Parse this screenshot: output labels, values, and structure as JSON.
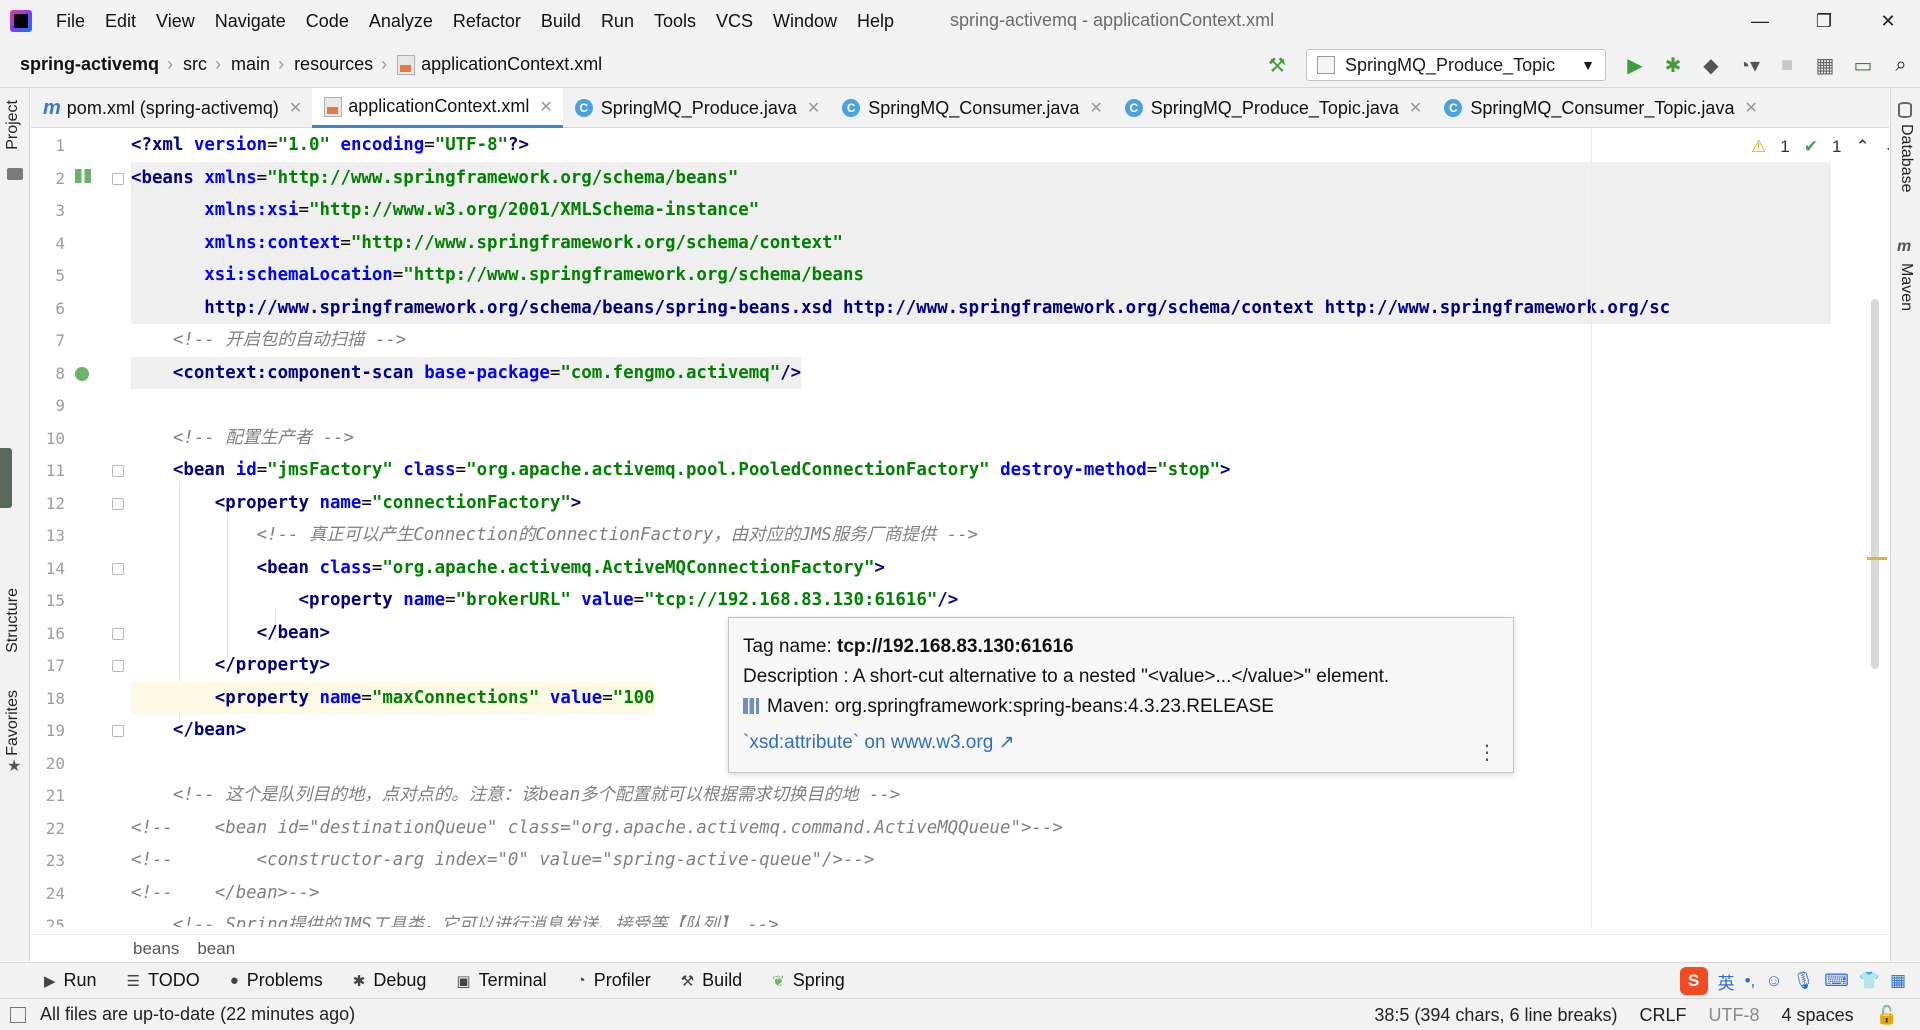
{
  "window": {
    "title": "spring-activemq - applicationContext.xml",
    "menu": [
      "File",
      "Edit",
      "View",
      "Navigate",
      "Code",
      "Analyze",
      "Refactor",
      "Build",
      "Run",
      "Tools",
      "VCS",
      "Window",
      "Help"
    ],
    "controls": {
      "minimize": "—",
      "maximize": "❐",
      "close": "✕"
    }
  },
  "navbar": {
    "breadcrumbs": [
      "spring-activemq",
      "src",
      "main",
      "resources",
      "applicationContext.xml"
    ],
    "run_config": "SpringMQ_Produce_Topic",
    "icons": [
      "hammer-icon",
      "run-icon",
      "debug-icon",
      "coverage-icon",
      "profile-icon",
      "stop-icon",
      "project-structure-icon",
      "terminal-icon",
      "search-icon"
    ]
  },
  "side_tabs": {
    "left": [
      "Project",
      "Structure",
      "Favorites"
    ],
    "right": [
      "Database",
      "Maven"
    ]
  },
  "tabs": [
    {
      "label": "pom.xml (spring-activemq)",
      "icon": "maven-icon",
      "close": "✕"
    },
    {
      "label": "applicationContext.xml",
      "icon": "xml-icon",
      "close": "✕"
    },
    {
      "label": "SpringMQ_Produce.java",
      "icon": "class-icon",
      "close": "✕"
    },
    {
      "label": "SpringMQ_Consumer.java",
      "icon": "class-icon",
      "close": "✕"
    },
    {
      "label": "SpringMQ_Produce_Topic.java",
      "icon": "class-icon",
      "close": "✕"
    },
    {
      "label": "SpringMQ_Consumer_Topic.java",
      "icon": "class-icon",
      "close": "✕"
    }
  ],
  "inspections": {
    "warnings": "1",
    "weak_warnings": "1"
  },
  "editor": {
    "line_numbers": [
      "1",
      "2",
      "3",
      "4",
      "5",
      "6",
      "7",
      "8",
      "9",
      "10",
      "11",
      "12",
      "13",
      "14",
      "15",
      "16",
      "17",
      "18",
      "19",
      "20",
      "21",
      "22",
      "23",
      "24",
      "25"
    ],
    "lines": [
      "<?xml version=\"1.0\" encoding=\"UTF-8\"?>",
      "<beans xmlns=\"http://www.springframework.org/schema/beans\"",
      "       xmlns:xsi=\"http://www.w3.org/2001/XMLSchema-instance\"",
      "       xmlns:context=\"http://www.springframework.org/schema/context\"",
      "       xsi:schemaLocation=\"http://www.springframework.org/schema/beans",
      "       http://www.springframework.org/schema/beans/spring-beans.xsd http://www.springframework.org/schema/context http://www.springframework.org/sc",
      "    <!-- 开启包的自动扫描 -->",
      "    <context:component-scan base-package=\"com.fengmo.activemq\"/>",
      "",
      "    <!-- 配置生产者 -->",
      "    <bean id=\"jmsFactory\" class=\"org.apache.activemq.pool.PooledConnectionFactory\" destroy-method=\"stop\">",
      "        <property name=\"connectionFactory\">",
      "            <!-- 真正可以产生Connection的ConnectionFactory，由对应的JMS服务厂商提供 -->",
      "            <bean class=\"org.apache.activemq.ActiveMQConnectionFactory\">",
      "                <property name=\"brokerURL\" value=\"tcp://192.168.83.130:61616\"/>",
      "            </bean>",
      "        </property>",
      "        <property name=\"maxConnections\" value=\"100",
      "    </bean>",
      "",
      "    <!-- 这个是队列目的地，点对点的。注意：该bean多个配置就可以根据需求切换目的地 -->",
      "<!--    <bean id=\"destinationQueue\" class=\"org.apache.activemq.command.ActiveMQQueue\">-->",
      "<!--        <constructor-arg index=\"0\" value=\"spring-active-queue\"/>-->",
      "<!--    </bean>-->",
      "    <!-- Spring提供的JMS工具类，它可以进行消息发送、接受等【队列】 -->"
    ]
  },
  "tooltip": {
    "tag_label": "Tag name: ",
    "tag_value": "tcp://192.168.83.130:61616",
    "description": "Description : A short-cut alternative to a nested \"<value>...</value>\" element.",
    "maven": "Maven: org.springframework:spring-beans:4.3.23.RELEASE",
    "link": "`xsd:attribute` on www.w3.org ↗",
    "more": "⋮"
  },
  "editor_breadcrumb": [
    "beans",
    "bean"
  ],
  "tool_windows": [
    {
      "label": "Run",
      "icon": "run-icon"
    },
    {
      "label": "TODO",
      "icon": "todo-icon"
    },
    {
      "label": "Problems",
      "icon": "problems-icon"
    },
    {
      "label": "Debug",
      "icon": "debug-icon"
    },
    {
      "label": "Terminal",
      "icon": "terminal-icon"
    },
    {
      "label": "Profiler",
      "icon": "profiler-icon"
    },
    {
      "label": "Build",
      "icon": "hammer-icon"
    },
    {
      "label": "Spring",
      "icon": "spring-leaf-icon"
    }
  ],
  "ime": {
    "logo": "S",
    "lang": "英"
  },
  "status": {
    "message": "All files are up-to-date (22 minutes ago)",
    "position": "38:5 (394 chars, 6 line breaks)",
    "line_sep": "CRLF",
    "encoding": "UTF-8",
    "indent": "4 spaces"
  }
}
